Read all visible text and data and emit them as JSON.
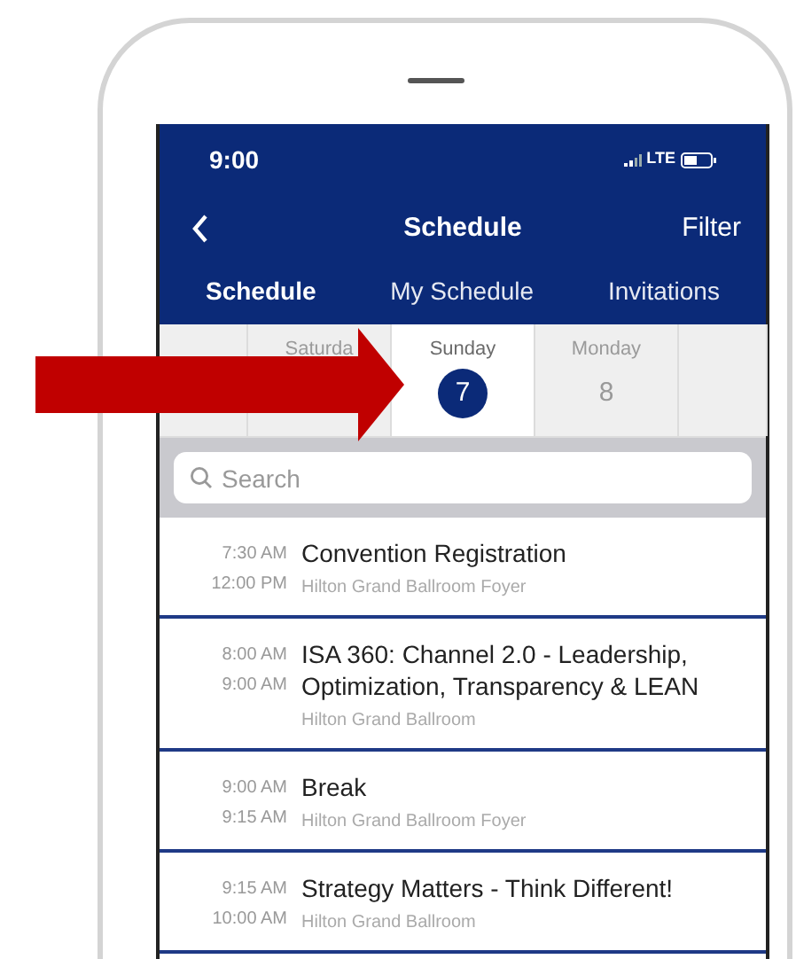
{
  "status_bar": {
    "time": "9:00",
    "network": "LTE"
  },
  "nav": {
    "title": "Schedule",
    "action": "Filter"
  },
  "tabs": [
    {
      "label": "Schedule",
      "selected": true
    },
    {
      "label": "My Schedule",
      "selected": false
    },
    {
      "label": "Invitations",
      "selected": false
    }
  ],
  "days": [
    {
      "kind": "blank"
    },
    {
      "kind": "day",
      "name": "Saturda",
      "selected": false
    },
    {
      "kind": "day",
      "name": "Sunday",
      "number": "7",
      "selected": true
    },
    {
      "kind": "day",
      "name": "Monday",
      "number": "8",
      "selected": false
    },
    {
      "kind": "blank"
    }
  ],
  "search": {
    "placeholder": "Search"
  },
  "sessions": [
    {
      "start": "7:30 AM",
      "end": "12:00 PM",
      "title": "Convention Registration",
      "location": "Hilton Grand Ballroom Foyer"
    },
    {
      "start": "8:00 AM",
      "end": "9:00 AM",
      "title": "ISA 360: Channel 2.0 - Leadership, Optimization, Transparency & LEAN",
      "location": "Hilton Grand Ballroom"
    },
    {
      "start": "9:00 AM",
      "end": "9:15 AM",
      "title": "Break",
      "location": "Hilton Grand Ballroom Foyer"
    },
    {
      "start": "9:15 AM",
      "end": "10:00 AM",
      "title": "Strategy Matters - Think Different!",
      "location": "Hilton Grand Ballroom"
    }
  ]
}
